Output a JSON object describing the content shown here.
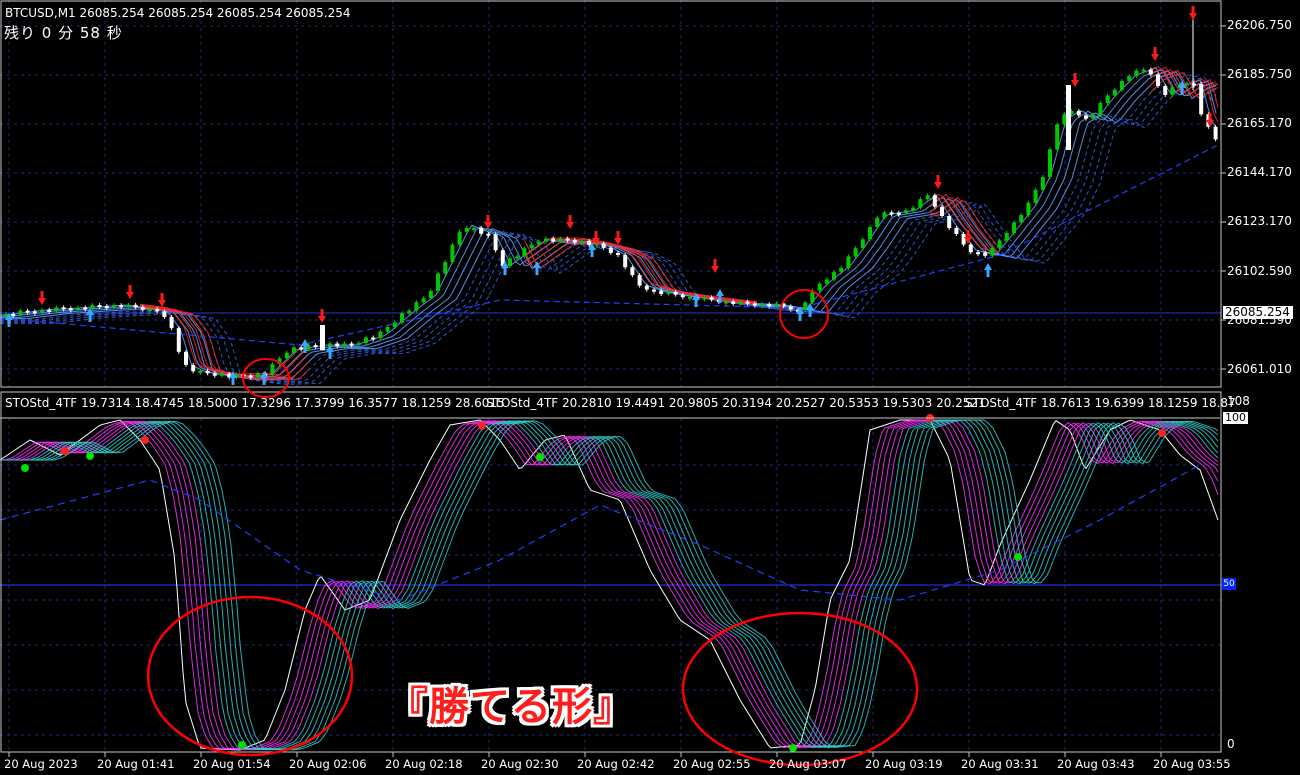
{
  "window": {
    "header": "BTCUSD,M1  26085.254 26085.254 26085.254 26085.254",
    "countdown": "残り 0 分 58 秒"
  },
  "price_axis": [
    "26206.750",
    "26185.750",
    "26165.170",
    "26144.170",
    "26123.170",
    "26102.590",
    "26081.590",
    "26061.010"
  ],
  "current_price": "26085.254",
  "subwindow": {
    "labels": [
      "STOStd_4TF 19.7314 18.4745 18.5000 17.3296 17.3799 16.3577 18.1259 28.6015",
      "STOStd_4TF 20.2810 19.4491 20.9805 20.3194 20.2527 20.5353 19.5303 20.2521",
      "STOStd_4TF 18.7613 19.6399 18.1259 18.87"
    ],
    "scale_top": "108",
    "scale_100": "100",
    "scale_0": "0",
    "level_badge": "50"
  },
  "time_axis": [
    "20 Aug 2023",
    "20 Aug 01:41",
    "20 Aug 01:54",
    "20 Aug 02:06",
    "20 Aug 02:18",
    "20 Aug 02:30",
    "20 Aug 02:42",
    "20 Aug 02:55",
    "20 Aug 03:07",
    "20 Aug 03:19",
    "20 Aug 03:31",
    "20 Aug 03:43",
    "20 Aug 03:55"
  ],
  "caption": "『勝てる形』",
  "colors": {
    "bull": "#00c800",
    "bear": "#ffffff",
    "ma_up": "#4da6ff",
    "ma_down": "#ff2a2a",
    "grid": "#1e2a78",
    "stoch_a": "#ff33ff",
    "stoch_b": "#33cccc",
    "marker_circle": "#ff0000"
  }
}
